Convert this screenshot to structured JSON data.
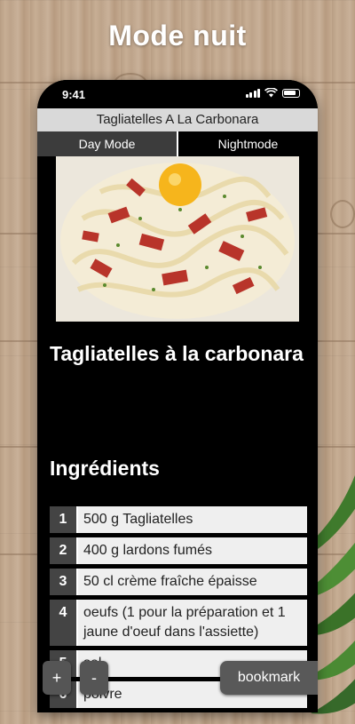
{
  "header": {
    "title": "Mode nuit"
  },
  "status_bar": {
    "time": "9:41"
  },
  "app": {
    "nav_title": "Tagliatelles A La Carbonara",
    "tabs": [
      {
        "label": "Day Mode",
        "selected": false
      },
      {
        "label": "Nightmode",
        "selected": true
      }
    ],
    "recipe_title": "Tagliatelles à la carbonara",
    "ingredients_heading": "Ingrédients",
    "ingredients": [
      {
        "num": "1",
        "text": "500 g Tagliatelles"
      },
      {
        "num": "2",
        "text": "400 g lardons fumés"
      },
      {
        "num": "3",
        "text": "50 cl crème fraîche épaisse"
      },
      {
        "num": "4",
        "text": "oeufs (1 pour la préparation et 1 jaune d'oeuf dans l'assiette)"
      },
      {
        "num": "5",
        "text": "sel"
      },
      {
        "num": "6",
        "text": "poivre"
      }
    ],
    "zoom_in_label": "+",
    "zoom_out_label": "-",
    "bookmark_label": "bookmark"
  },
  "colors": {
    "background_wood": "#c4aa90",
    "night_bg": "#000000",
    "ingredient_cell": "#efefef",
    "number_cell": "#444444"
  }
}
